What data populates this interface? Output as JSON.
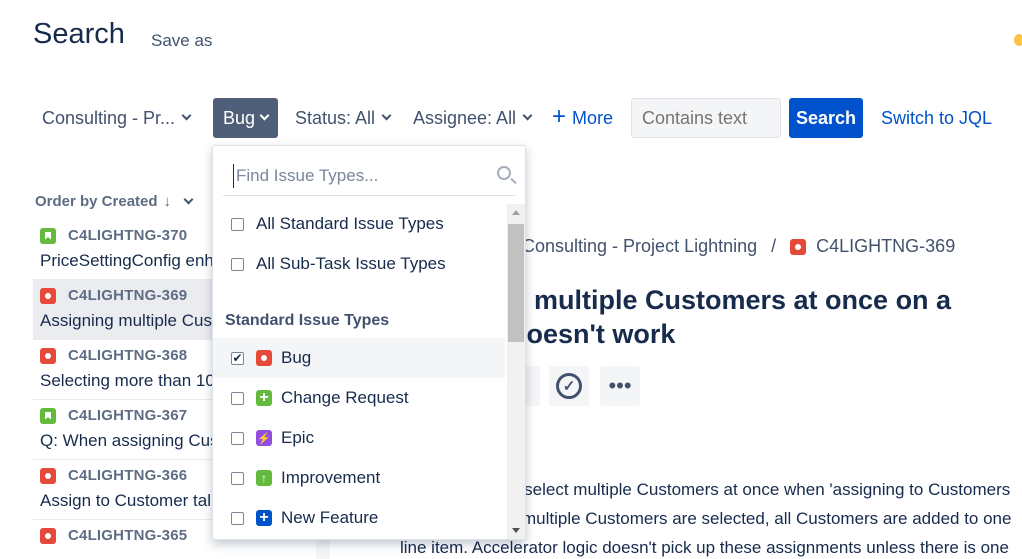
{
  "header": {
    "title": "Search",
    "save_as": "Save as"
  },
  "filters": {
    "project": "Consulting - Pr...",
    "type": "Bug",
    "status": "Status: All",
    "assignee": "Assignee: All",
    "more": "More",
    "text_placeholder": "Contains text",
    "search_button": "Search",
    "switch_jql": "Switch to JQL"
  },
  "list": {
    "order_by": "Order by Created",
    "issues": [
      {
        "key": "C4LIGHTNG-370",
        "type": "story",
        "summary": "PriceSettingConfig enh"
      },
      {
        "key": "C4LIGHTNG-369",
        "type": "bug",
        "summary": "Assigning multiple Cus"
      },
      {
        "key": "C4LIGHTNG-368",
        "type": "bug",
        "summary": "Selecting more than 10"
      },
      {
        "key": "C4LIGHTNG-367",
        "type": "story",
        "summary": "Q: When assigning Cus"
      },
      {
        "key": "C4LIGHTNG-366",
        "type": "bug",
        "summary": "Assign to Customer tal"
      },
      {
        "key": "C4LIGHTNG-365",
        "type": "bug",
        "summary": ""
      }
    ]
  },
  "detail": {
    "breadcrumb_project": "Consulting - Project Lightning",
    "breadcrumb_separator": "/",
    "breadcrumb_key": "C4LIGHTNG-369",
    "title_line1": "g multiple Customers at once on a",
    "title_line2": "doesn't work",
    "description_lines": [
      "o select multiple Customers at once when 'assigning to Customers",
      "multiple Customers are selected, all Customers are added to one",
      "line item. Accelerator logic doesn't pick up these assignments unless there is one"
    ]
  },
  "dropdown": {
    "search_placeholder": "Find Issue Types...",
    "options_all": [
      {
        "label": "All Standard Issue Types",
        "checked": false
      },
      {
        "label": "All Sub-Task Issue Types",
        "checked": false
      }
    ],
    "group_label": "Standard Issue Types",
    "options": [
      {
        "label": "Bug",
        "icon": "bug-icon",
        "checked": true
      },
      {
        "label": "Change Request",
        "icon": "change-request-icon",
        "checked": false
      },
      {
        "label": "Epic",
        "icon": "epic-icon",
        "checked": false
      },
      {
        "label": "Improvement",
        "icon": "improvement-icon",
        "checked": false
      },
      {
        "label": "New Feature",
        "icon": "new-feature-icon",
        "checked": false
      }
    ]
  },
  "colors": {
    "primary": "#0052cc",
    "bug": "#e5493a",
    "story": "#63ba3c",
    "epic": "#904ee2",
    "selected_filter": "#505f79"
  }
}
